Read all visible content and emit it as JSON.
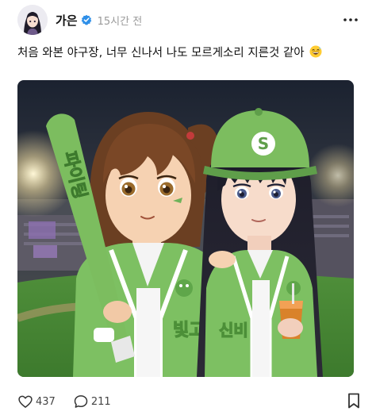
{
  "post": {
    "author": "가은",
    "time": "15시간 전",
    "caption": "처음 와본 야구장, 너무 신나서 나도 모르게소리 지른것 같아",
    "image": {
      "cap_letter": "S",
      "bat_text": "파이팅",
      "jersey_left": "빛고",
      "jersey_right": "신비"
    },
    "likes": "437",
    "comments": "211"
  },
  "icons": {
    "verified": "verified-badge-icon",
    "more": "more-dots-icon",
    "like": "heart-icon",
    "comment": "comment-bubble-icon",
    "bookmark": "bookmark-icon"
  },
  "colors": {
    "verified_blue": "#2e8fe8",
    "team_green": "#6fb35a",
    "cap_green": "#5f9e4a"
  }
}
